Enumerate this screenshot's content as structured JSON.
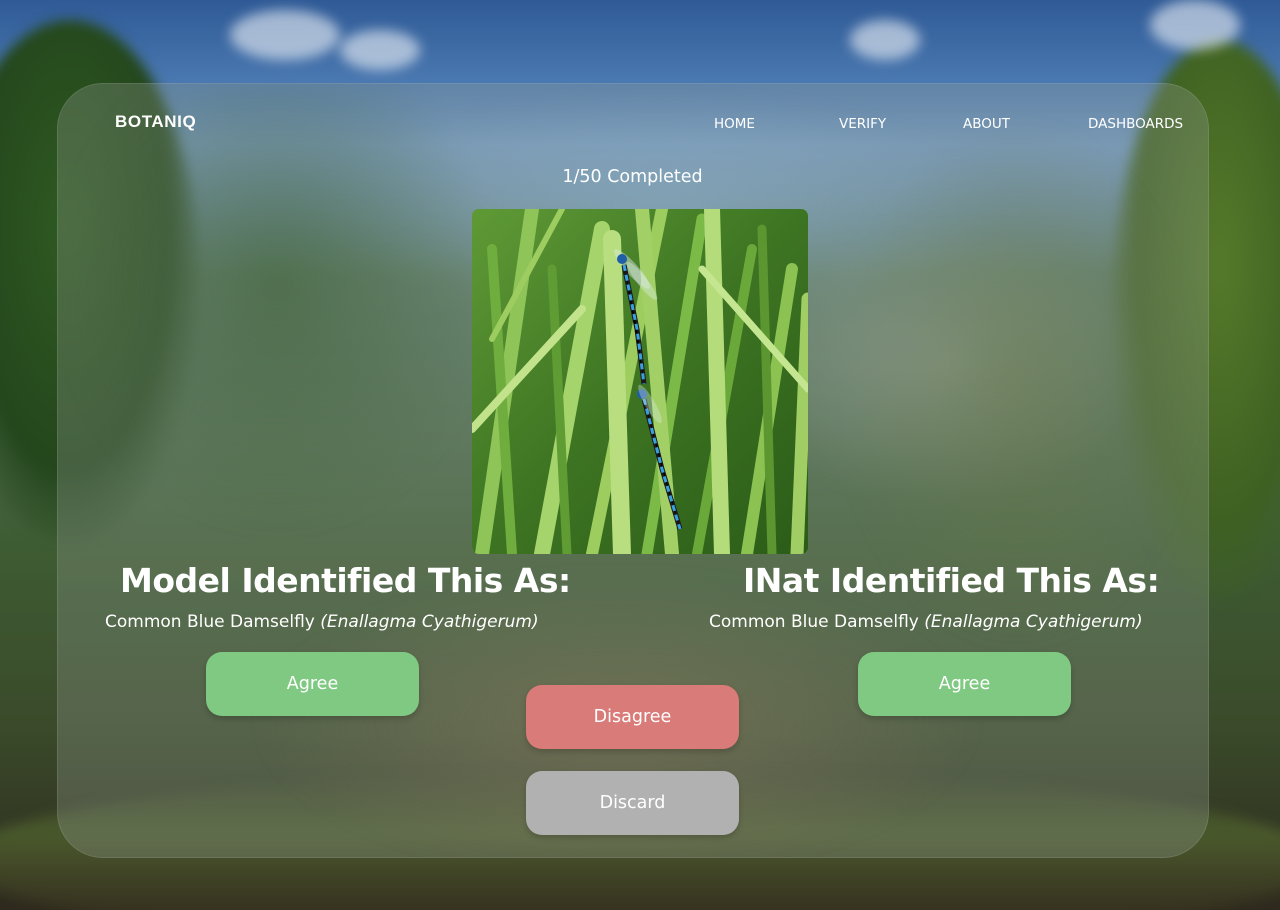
{
  "nav": {
    "brand": "BOTANIQ",
    "links": [
      "HOME",
      "VERIFY",
      "ABOUT",
      "DASHBOARDS"
    ]
  },
  "progress": {
    "text": "1/50 Completed",
    "completed": 1,
    "total": 50
  },
  "image": {
    "subject": "damselfly-on-grass"
  },
  "model": {
    "title": "Model Identified This As:",
    "common_name": "Common Blue Damselfly",
    "scientific_name": "(Enallagma Cyathigerum)",
    "agree_label": "Agree"
  },
  "inat": {
    "title": "INat Identified This As:",
    "common_name": "Common Blue Damselfly",
    "scientific_name": "(Enallagma Cyathigerum)",
    "agree_label": "Agree"
  },
  "actions": {
    "disagree_label": "Disagree",
    "discard_label": "Discard"
  },
  "colors": {
    "agree": "#80c983",
    "disagree": "#d97b78",
    "discard": "#b1b1b1",
    "text": "#ffffff"
  }
}
